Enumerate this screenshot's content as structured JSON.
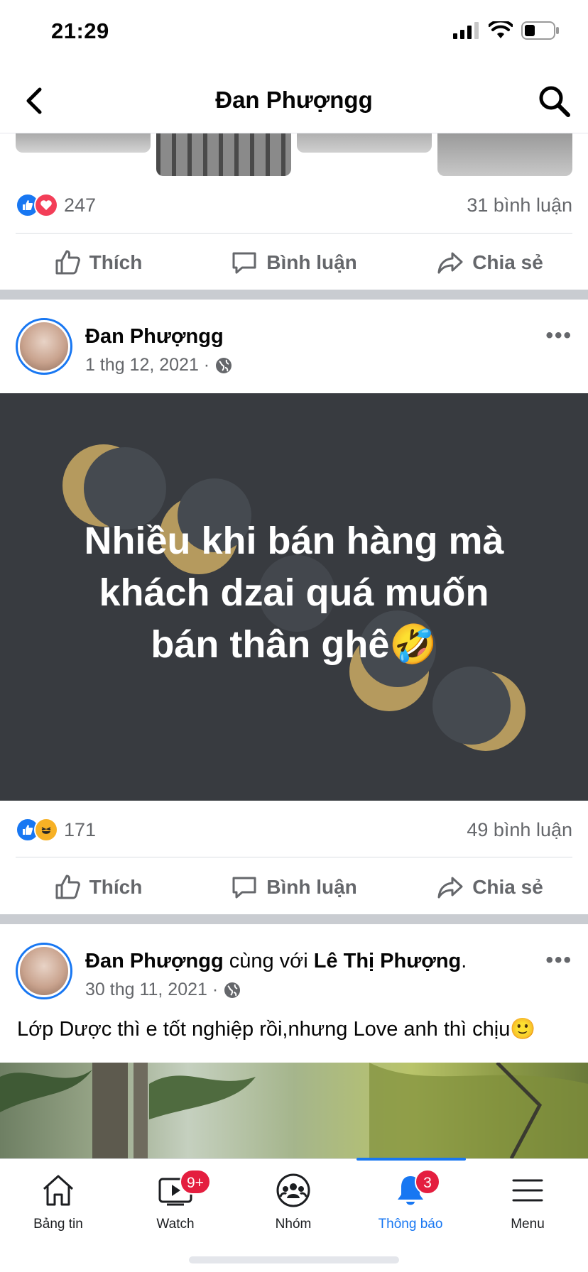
{
  "status_bar": {
    "time": "21:29"
  },
  "nav": {
    "title": "Đan Phượngg"
  },
  "post1": {
    "reaction_count": "247",
    "comment_count": "31 bình luận",
    "actions": {
      "like": "Thích",
      "comment": "Bình luận",
      "share": "Chia sẻ"
    }
  },
  "post2": {
    "author": "Đan Phượngg",
    "date": "1 thg 12, 2021 ·",
    "status_lines": [
      "Nhiều khi bán hàng mà",
      "khách dzai quá muốn",
      "bán thân ghê🤣"
    ],
    "reaction_count": "171",
    "comment_count": "49 bình luận",
    "actions": {
      "like": "Thích",
      "comment": "Bình luận",
      "share": "Chia sẻ"
    },
    "background_color": "#383b40"
  },
  "post3": {
    "author": "Đan Phượngg",
    "with_text": "cùng với",
    "tagged": "Lê Thị Phượng",
    "period": ".",
    "date": "30 thg 11, 2021 ·",
    "caption": "Lớp Dược thì e tốt nghiệp rồi,nhưng Love anh thì chịu🙂"
  },
  "tabs": [
    {
      "label": "Bảng tin",
      "icon": "home-icon"
    },
    {
      "label": "Watch",
      "icon": "watch-icon",
      "badge": "9+"
    },
    {
      "label": "Nhóm",
      "icon": "groups-icon"
    },
    {
      "label": "Thông báo",
      "icon": "bell-icon",
      "badge": "3",
      "active": true
    },
    {
      "label": "Menu",
      "icon": "menu-icon"
    }
  ],
  "colors": {
    "accent": "#1877f2",
    "badge": "#e41e3f",
    "muted_text": "#65676b"
  }
}
